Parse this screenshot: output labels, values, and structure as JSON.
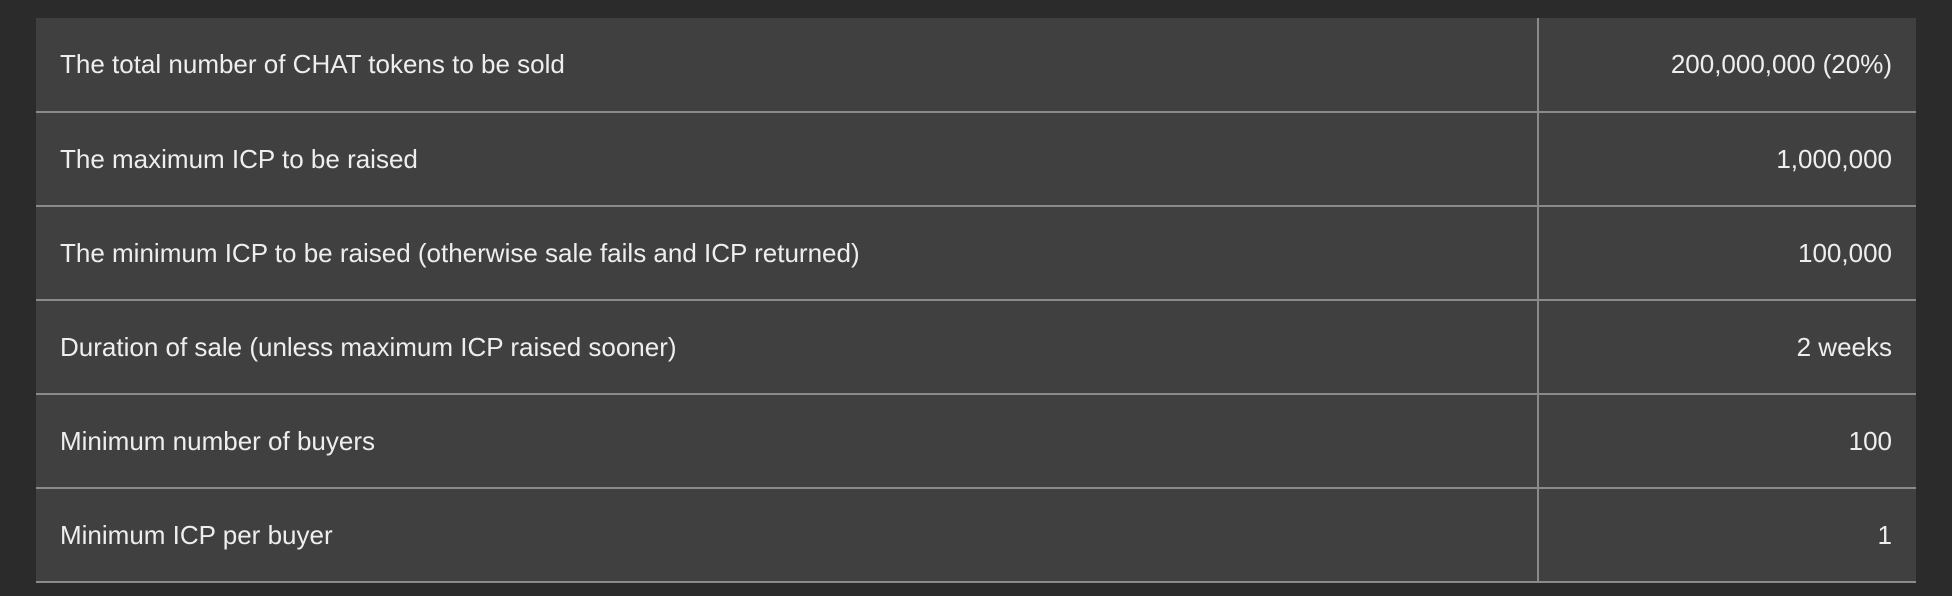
{
  "sale_table": {
    "rows": [
      {
        "label": "The total number of CHAT tokens to be sold",
        "value": "200,000,000 (20%)"
      },
      {
        "label": "The maximum ICP to be raised",
        "value": "1,000,000"
      },
      {
        "label": "The minimum ICP to be raised (otherwise sale fails and ICP returned)",
        "value": "100,000"
      },
      {
        "label": "Duration of sale (unless maximum ICP raised sooner)",
        "value": "2 weeks"
      },
      {
        "label": "Minimum number of buyers",
        "value": "100"
      },
      {
        "label": "Minimum ICP per buyer",
        "value": "1"
      }
    ]
  },
  "colors": {
    "page_background": "#2b2b2b",
    "table_background": "#404040",
    "border": "#8a8a8a",
    "text": "#eeeeee"
  }
}
